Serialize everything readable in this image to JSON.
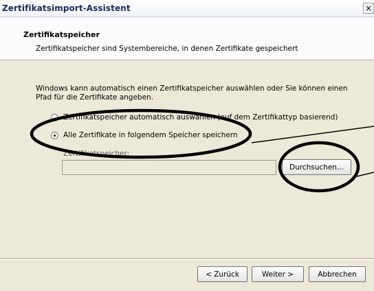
{
  "window": {
    "title": "Zertifikatsimport-Assistent",
    "close_glyph": "×"
  },
  "header": {
    "title": "Zertifikatspeicher",
    "subtitle": "Zertifikatspeicher sind Systembereiche, in denen Zertifikate gespeichert"
  },
  "content": {
    "intro_line1": "Windows kann automatisch einen Zertifikatspeicher auswählen oder Sie können einen",
    "intro_line2": "Pfad für die Zertifikate angeben.",
    "option_auto": {
      "label": "Zertifikatspeicher automatisch auswählen (auf dem Zertifikattyp basierend)",
      "checked": false
    },
    "option_manual": {
      "label": "Alle Zertifikate in folgendem Speicher speichern",
      "checked": true
    },
    "store_label": "Zertifikatspeicher:",
    "store_value": "",
    "browse_button": "Durchsuchen..."
  },
  "footer": {
    "back_button": "< Zurück",
    "next_button": "Weiter >",
    "cancel_button": "Abbrechen"
  },
  "annotation": {
    "ink_color": "#000000"
  }
}
